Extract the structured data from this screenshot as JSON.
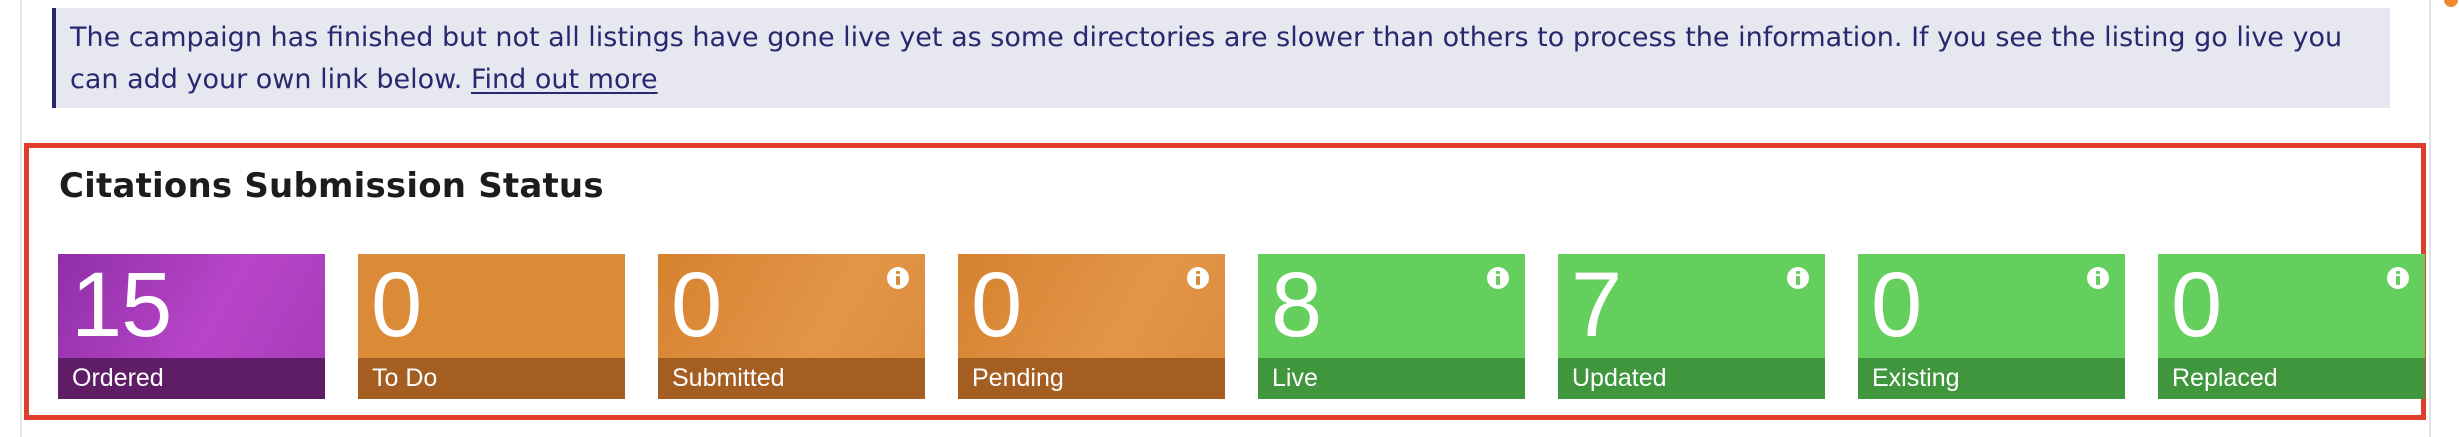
{
  "notice": {
    "text": "The campaign has finished but not all listings have gone live yet as some directories are slower than others to process the information. If you see the listing go live you can add your own link below.",
    "link_label": "Find out more"
  },
  "status_panel": {
    "title": "Citations Submission Status",
    "tiles": [
      {
        "count": "15",
        "label": "Ordered",
        "status": "ordered",
        "has_info": false,
        "top_color": "#a63cb8",
        "bottom_color": "#5f1d66"
      },
      {
        "count": "0",
        "label": "To Do",
        "status": "todo",
        "has_info": false,
        "top_color": "#db8a38",
        "bottom_color": "#a55e21"
      },
      {
        "count": "0",
        "label": "Submitted",
        "status": "submitted",
        "has_info": true,
        "top_color": "#db8a38",
        "bottom_color": "#a55e21"
      },
      {
        "count": "0",
        "label": "Pending",
        "status": "pending",
        "has_info": true,
        "top_color": "#db8a38",
        "bottom_color": "#a55e21"
      },
      {
        "count": "8",
        "label": "Live",
        "status": "live",
        "has_info": true,
        "top_color": "#64cf5c",
        "bottom_color": "#3f963c"
      },
      {
        "count": "7",
        "label": "Updated",
        "status": "updated",
        "has_info": true,
        "top_color": "#64cf5c",
        "bottom_color": "#3f963c"
      },
      {
        "count": "0",
        "label": "Existing",
        "status": "existing",
        "has_info": true,
        "top_color": "#64cf5c",
        "bottom_color": "#3f963c"
      },
      {
        "count": "0",
        "label": "Replaced",
        "status": "replaced",
        "has_info": true,
        "top_color": "#64cf5c",
        "bottom_color": "#3f963c"
      }
    ]
  },
  "colors": {
    "notice_background": "#e7e7f0",
    "notice_text": "#27286f",
    "highlight_border": "#e03e2d"
  }
}
